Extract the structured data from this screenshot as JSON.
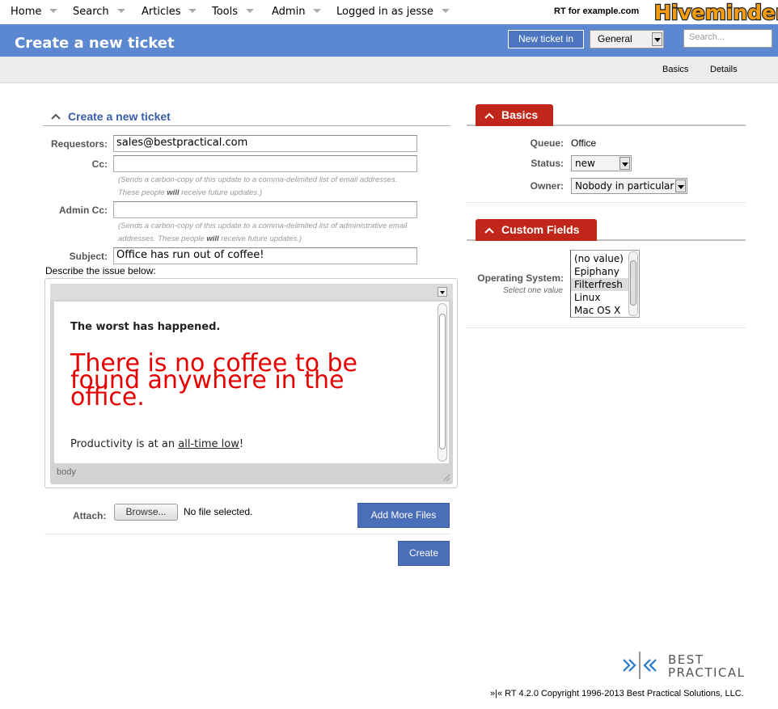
{
  "top_menu": {
    "items": [
      {
        "label": "Home"
      },
      {
        "label": "Search"
      },
      {
        "label": "Articles"
      },
      {
        "label": "Tools"
      },
      {
        "label": "Admin"
      },
      {
        "label": "Logged in as jesse"
      }
    ],
    "rt_for": "RT for example.com",
    "logo_text": "Hiveminder"
  },
  "header": {
    "title": "Create a new ticket",
    "new_ticket_button": "New ticket in",
    "queue_selected": "General",
    "search_placeholder": "Search..."
  },
  "tabs": [
    {
      "label": "Basics"
    },
    {
      "label": "Details"
    }
  ],
  "form": {
    "section_title": "Create a new ticket",
    "requestors_label": "Requestors:",
    "requestors_value": "sales@bestpractical.com",
    "cc_label": "Cc:",
    "cc_hint_line1": "(Sends a carbon-copy of this update to a comma-delimited list of email addresses.",
    "cc_hint_line2_pre": "These people ",
    "cc_hint_line2_bold": "will",
    "cc_hint_line2_post": " receive future updates.)",
    "admin_cc_label": "Admin Cc:",
    "admin_cc_hint_line1": "(Sends a carbon-copy of this update to a comma-delimited list of administrative email",
    "admin_cc_hint_line2_pre": "addresses. These people ",
    "admin_cc_hint_line2_bold": "will",
    "admin_cc_hint_line2_post": " receive future updates.)",
    "subject_label": "Subject:",
    "subject_value": "Office has run out of coffee!",
    "describe_label": "Describe the issue below:",
    "editor": {
      "bold_line": "The worst has happened.",
      "red_line": "There is no coffee to be found anywhere in the office.",
      "last_line_pre": "Productivity is at an ",
      "last_line_link": "all-time low",
      "last_line_post": "!",
      "path": "body"
    },
    "attach_label": "Attach:",
    "browse_button": "Browse...",
    "no_file": "No file selected.",
    "add_more_files_button": "Add More Files",
    "create_button": "Create"
  },
  "basics": {
    "title": "Basics",
    "queue_label": "Queue:",
    "queue_value": "Office",
    "status_label": "Status:",
    "status_value": "new",
    "owner_label": "Owner:",
    "owner_value": "Nobody in particular"
  },
  "custom_fields": {
    "title": "Custom Fields",
    "os_label": "Operating System:",
    "os_hint": "Select one value",
    "os_options": [
      {
        "label": "(no value)",
        "selected": false
      },
      {
        "label": "Epiphany",
        "selected": false
      },
      {
        "label": "Filterfresh",
        "selected": true
      },
      {
        "label": "Linux",
        "selected": false
      },
      {
        "label": "Mac OS X",
        "selected": false
      }
    ]
  },
  "footer": {
    "logo_line1": "BEST",
    "logo_line2": "PRACTICAL",
    "copyright": "»|« RT 4.2.0 Copyright 1996-2013 Best Practical Solutions, LLC."
  },
  "colors": {
    "header_blue": "#5b88d0",
    "panel_red": "#c0271a",
    "primary_button": "#4b6eb8",
    "error_text_red": "#e60000"
  }
}
